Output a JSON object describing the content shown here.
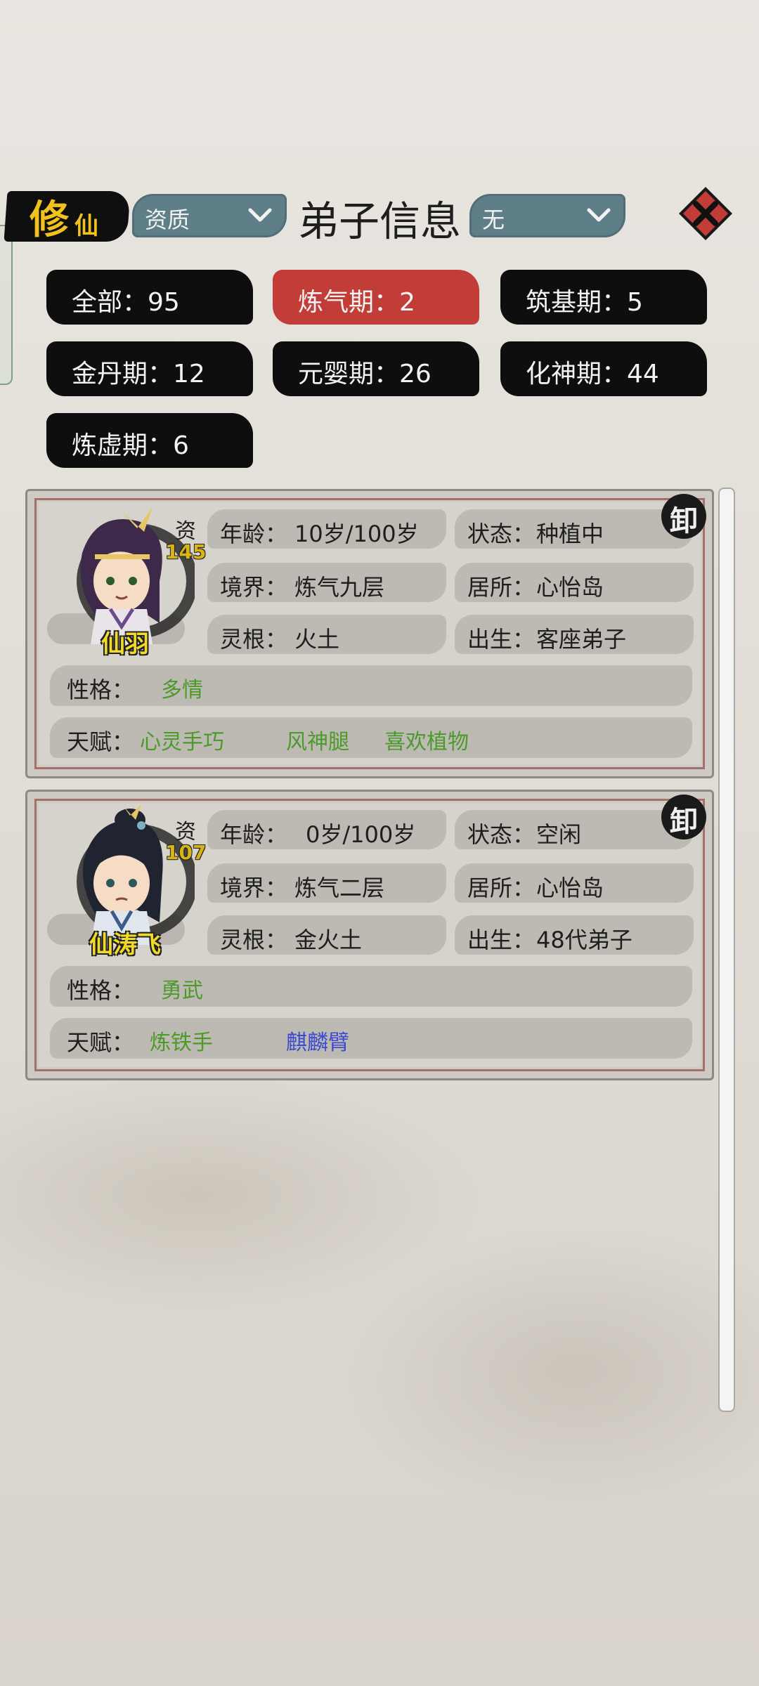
{
  "header": {
    "logo_main": "修",
    "logo_sub": "仙",
    "title": "弟子信息",
    "sort_dropdown": {
      "value": "资质",
      "icon": "chevron-down-icon"
    },
    "filter_dropdown": {
      "value": "无",
      "icon": "chevron-down-icon"
    },
    "close_icon": "close-icon"
  },
  "filters": [
    {
      "label": "全部",
      "count": "95",
      "display": "全部：95"
    },
    {
      "label": "炼气期",
      "count": "2",
      "display": "炼气期：2",
      "active": true
    },
    {
      "label": "筑基期",
      "count": "5",
      "display": "筑基期：5"
    },
    {
      "label": "金丹期",
      "count": "12",
      "display": "金丹期：12"
    },
    {
      "label": "元婴期",
      "count": "26",
      "display": "元婴期：26"
    },
    {
      "label": "化神期",
      "count": "44",
      "display": "化神期：44"
    },
    {
      "label": "炼虚期",
      "count": "6",
      "display": "炼虚期：6"
    }
  ],
  "labels": {
    "zi": "资",
    "age": "年龄：",
    "status": "状态：",
    "realm": "境界：",
    "residence": "居所：",
    "root": "灵根：",
    "origin": "出生：",
    "personality": "性格：",
    "talent": "天赋：",
    "seal": "卸"
  },
  "disciples": [
    {
      "name": "仙羽",
      "aptitude": "145",
      "age": "10岁/100岁",
      "status": "种植中",
      "realm": "炼气九层",
      "residence": "心怡岛",
      "root": "火土",
      "root_color": "#9b3ad6",
      "origin": "客座弟子",
      "personality": "多情",
      "talents": [
        "心灵手巧",
        "风神腿",
        "喜欢植物"
      ]
    },
    {
      "name": "仙涛飞",
      "aptitude": "107",
      "age": "0岁/100岁",
      "status": "空闲",
      "realm": "炼气二层",
      "residence": "心怡岛",
      "root": "金火土",
      "root_color": "#3c4ad0",
      "origin": "48代弟子",
      "personality": "勇武",
      "talents": [
        "炼铁手",
        "麒麟臂"
      ]
    }
  ],
  "colors": {
    "accent_red": "#c23d38",
    "dropdown": "#5f7f88",
    "name_yellow": "#f1da2a",
    "talent_green": "#4c9a2a",
    "talent_blue": "#3c4ad0"
  }
}
